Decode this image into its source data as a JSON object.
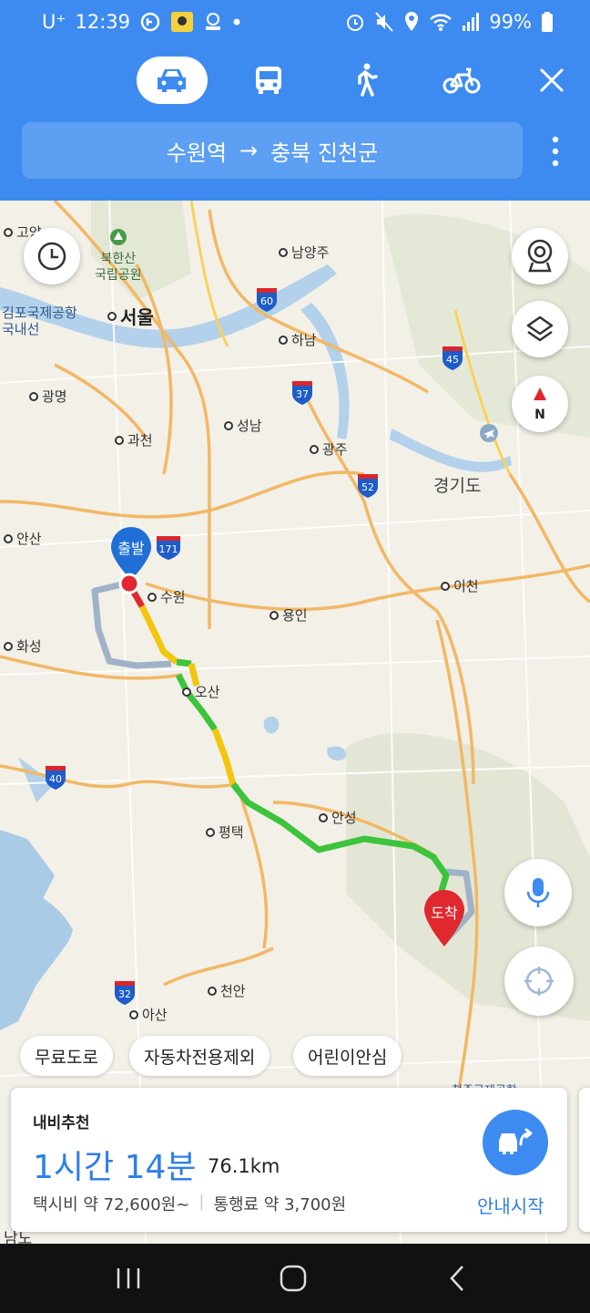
{
  "status": {
    "carrier": "U⁺",
    "time": "12:39",
    "battery": "99%"
  },
  "modes": [
    {
      "name": "car",
      "icon": "car-icon",
      "active": true
    },
    {
      "name": "bus",
      "icon": "bus-icon",
      "active": false
    },
    {
      "name": "walk",
      "icon": "walk-icon",
      "active": false
    },
    {
      "name": "bike",
      "icon": "bike-icon",
      "active": false
    }
  ],
  "route": {
    "origin": "수원역",
    "arrow": "→",
    "destination": "충북 진천군"
  },
  "map": {
    "places": {
      "goyang": "고양",
      "bukhansan": "북한산",
      "park": "국립공원",
      "namyangju": "남양주",
      "gimpo": "김포국제공항",
      "gimpo2": "국내선",
      "seoul": "서울",
      "hanam": "하남",
      "gwangmyeong": "광명",
      "seongnam": "성남",
      "gwacheon": "과천",
      "gwangju": "광주",
      "gyeonggi": "경기도",
      "ansan": "안산",
      "suwon": "수원",
      "icheon": "이천",
      "yongin": "용인",
      "hwaseong": "화성",
      "osan": "오산",
      "anseong": "안성",
      "pyeongtaek": "평택",
      "cheonan": "천안",
      "asan": "아산",
      "cheongju_airport": "청주국제공항",
      "namu": "남노"
    },
    "highway_shields": {
      "h60": "60",
      "h37": "37",
      "h45": "45",
      "h52": "52",
      "h171": "171",
      "h40": "40",
      "h32": "32"
    },
    "markers": {
      "start": "출발",
      "end": "도착"
    },
    "colors": {
      "route_green": "#3cc43c",
      "route_yellow": "#f2c60c",
      "route_alt": "#9fb3c8",
      "start": "#1f6fd6",
      "end": "#e0282e"
    }
  },
  "filters": [
    "무료도로",
    "자동차전용제외",
    "어린이안심"
  ],
  "summary": {
    "label": "내비추천",
    "duration": "1시간 14분",
    "distance": "76.1km",
    "taxi": "택시비 약 72,600원~",
    "toll": "통행료 약 3,700원",
    "start_label": "안내시작"
  }
}
